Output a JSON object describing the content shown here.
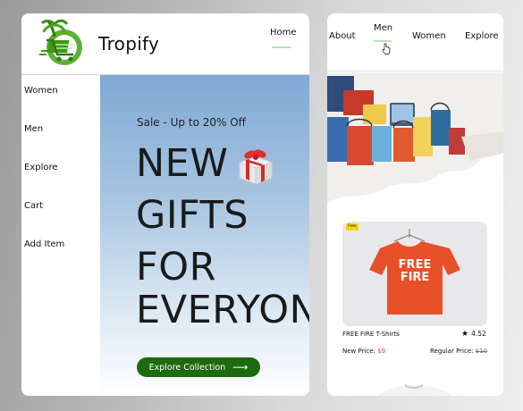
{
  "brand": {
    "name": "Tropify",
    "logo_icon": "shopping-cart-palm-icon"
  },
  "header": {
    "home_label": "Home"
  },
  "sidebar": {
    "items": [
      {
        "label": "Women"
      },
      {
        "label": "Men"
      },
      {
        "label": "Explore"
      },
      {
        "label": "Cart"
      },
      {
        "label": "Add Item"
      }
    ]
  },
  "hero": {
    "sale_text": "Sale - Up to 20% Off",
    "headline": [
      "NEW",
      "GIFTS",
      "FOR",
      "EVERYON"
    ],
    "gift_icon": "gift-box-icon",
    "cta_label": "Explore Collection",
    "cta_icon": "arrow-right-icon"
  },
  "right_nav": {
    "items": [
      {
        "label": "About"
      },
      {
        "label": "Men"
      },
      {
        "label": "Women"
      },
      {
        "label": "Explore"
      }
    ]
  },
  "product": {
    "badge": "Free",
    "shirt_text_line1": "FREE",
    "shirt_text_line2": "FIRE",
    "name": "FREE FIRE T-Shirts",
    "rating": "4.52",
    "new_price_label": "New Price:",
    "new_price_value": "$9",
    "regular_price_label": "Regular Price:",
    "regular_price_value": "$10"
  },
  "colors": {
    "accent_green": "#1d6a0f",
    "underline_green": "#b6e3b0",
    "price_red": "#e04a1b",
    "shirt_orange": "#e8502a"
  }
}
